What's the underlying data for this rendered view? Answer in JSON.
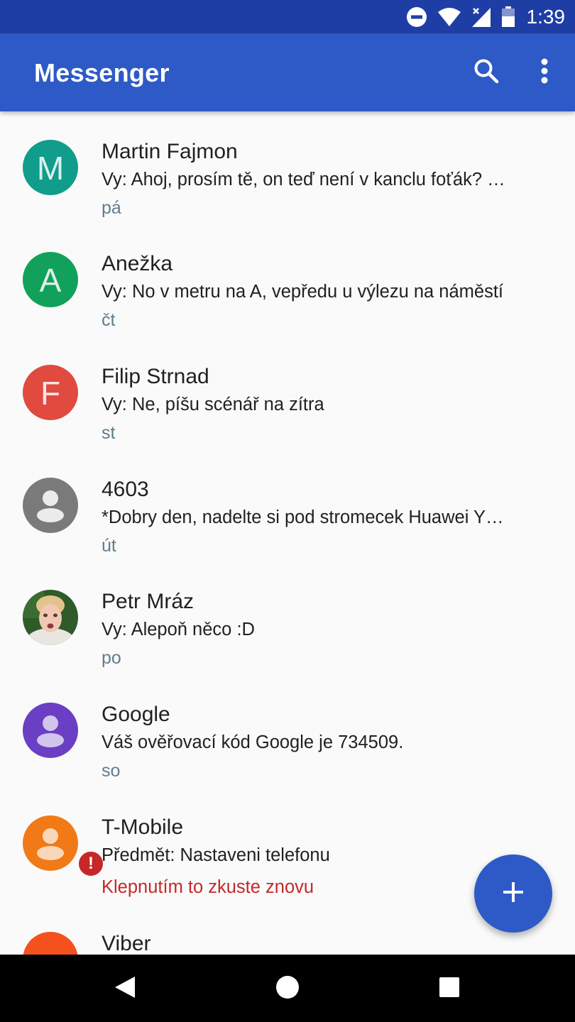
{
  "status_bar": {
    "time": "1:39",
    "icons": [
      "do-not-disturb-icon",
      "wifi-icon",
      "cell-signal-icon",
      "battery-icon"
    ]
  },
  "app_bar": {
    "title": "Messenger",
    "icons": [
      "search-icon",
      "more-vert-icon"
    ]
  },
  "conversations": [
    {
      "name": "Martin Fajmon",
      "snippet": "Vy: Ahoj, prosím tě, on teď není v kanclu foťák? …",
      "time": "pá",
      "avatar_letter": "M",
      "avatar_color": "#109d8c"
    },
    {
      "name": "Anežka",
      "snippet": "Vy: No v metru na A, vepředu u výlezu na náměstí",
      "time": "čt",
      "avatar_letter": "A",
      "avatar_color": "#12a15b"
    },
    {
      "name": "Filip Strnad",
      "snippet": "Vy: Ne, píšu scénář na zítra",
      "time": "st",
      "avatar_letter": "F",
      "avatar_color": "#e04a3f"
    },
    {
      "name": "4603",
      "snippet": "*Dobry den, nadelte si pod stromecek Huawei Y…",
      "time": "út",
      "avatar_icon": "person-icon",
      "avatar_color": "#7a7a7a"
    },
    {
      "name": "Petr Mráz",
      "snippet": "Vy: Alepoň něco :D",
      "time": "po",
      "avatar_icon": "contact-photo"
    },
    {
      "name": "Google",
      "snippet": "Váš ověřovací kód Google je 734509.",
      "time": "so",
      "avatar_icon": "person-icon",
      "avatar_color": "#6a3fc4"
    },
    {
      "name": "T-Mobile",
      "snippet": "Předmět: Nastaveni telefonu",
      "error": "Klepnutím to zkuste znovu",
      "avatar_icon": "person-icon",
      "avatar_color": "#f17a16",
      "error_color": "#c62828"
    },
    {
      "name": "Viber",
      "avatar_color": "#f4511e"
    }
  ],
  "fab": {
    "icon": "plus-icon"
  },
  "nav_bar": {
    "icons": [
      "back-icon",
      "home-icon",
      "recents-icon"
    ]
  },
  "colors": {
    "accent": "#2d5ac6",
    "status_bar": "#1f3ea5",
    "time_text": "#607d8b"
  }
}
